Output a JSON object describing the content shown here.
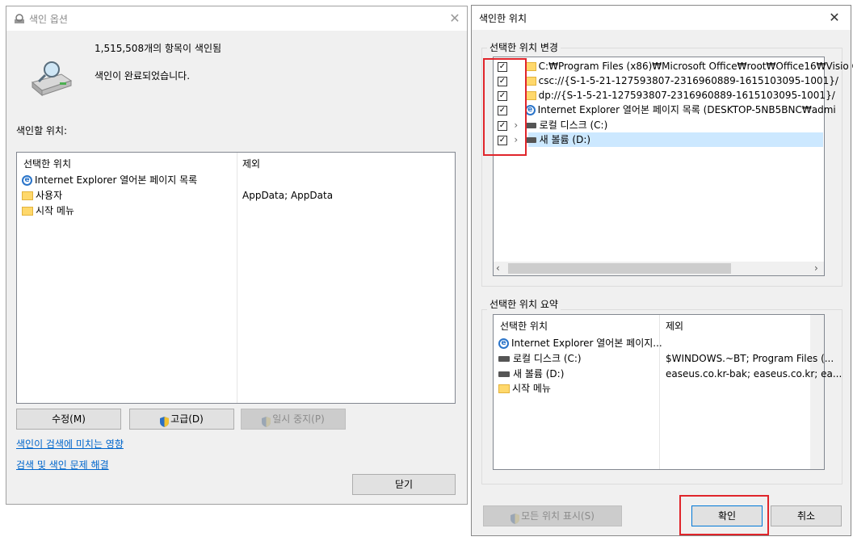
{
  "left": {
    "title": "색인 옵션",
    "item_count": "1,515,508개의 항목이 색인됨",
    "status": "색인이 완료되었습니다.",
    "locations_label": "색인할 위치:",
    "columns": [
      "선택한 위치",
      "제외"
    ],
    "rows": [
      {
        "name": "Internet Explorer 열어본 페이지 목록",
        "exclude": "",
        "icon": "ie-icon"
      },
      {
        "name": "사용자",
        "exclude": "AppData; AppData",
        "icon": "folder-icon"
      },
      {
        "name": "시작 메뉴",
        "exclude": "",
        "icon": "folder-icon"
      }
    ],
    "buttons": {
      "modify": "수정(M)",
      "advanced": "고급(D)",
      "pause": "일시 중지(P)",
      "close": "닫기"
    },
    "links": {
      "effect": "색인이 검색에 미치는 영향",
      "troubleshoot": "검색 및 색인 문제 해결"
    }
  },
  "right": {
    "title": "색인한 위치",
    "change_group": "선택한 위치 변경",
    "tree": [
      {
        "label": "C:₩Program Files (x86)₩Microsoft Office₩root₩Office16₩Visio C",
        "icon": "folder-icon",
        "checked": true,
        "expander": false
      },
      {
        "label": "csc://{S-1-5-21-127593807-2316960889-1615103095-1001}/",
        "icon": "folder-icon",
        "checked": true,
        "expander": false
      },
      {
        "label": "dp://{S-1-5-21-127593807-2316960889-1615103095-1001}/",
        "icon": "folder-icon",
        "checked": true,
        "expander": false
      },
      {
        "label": "Internet Explorer 열어본 페이지 목록 (DESKTOP-5NB5BNC₩admi",
        "icon": "ie-icon",
        "checked": true,
        "expander": false
      },
      {
        "label": "로컬 디스크 (C:)",
        "icon": "drive-icon",
        "checked": true,
        "expander": true
      },
      {
        "label": "새 볼륨 (D:)",
        "icon": "drive-icon",
        "checked": true,
        "expander": true,
        "selected": true
      }
    ],
    "summary_group": "선택한 위치 요약",
    "summary_columns": [
      "선택한 위치",
      "제외"
    ],
    "summary_rows": [
      {
        "name": "Internet Explorer 열어본 페이지...",
        "exclude": "",
        "icon": "ie-icon"
      },
      {
        "name": "로컬 디스크 (C:)",
        "exclude": "$WINDOWS.~BT; Program Files (...",
        "icon": "drive-icon"
      },
      {
        "name": "새 볼륨 (D:)",
        "exclude": "easeus.co.kr-bak; easeus.co.kr; ea...",
        "icon": "drive-icon"
      },
      {
        "name": "시작 메뉴",
        "exclude": "",
        "icon": "folder-icon"
      }
    ],
    "buttons": {
      "show_all": "모든 위치 표시(S)",
      "ok": "확인",
      "cancel": "취소"
    }
  },
  "colors": {
    "highlight": "#e0252b",
    "selection": "#cce8ff",
    "link": "#0066cc"
  }
}
